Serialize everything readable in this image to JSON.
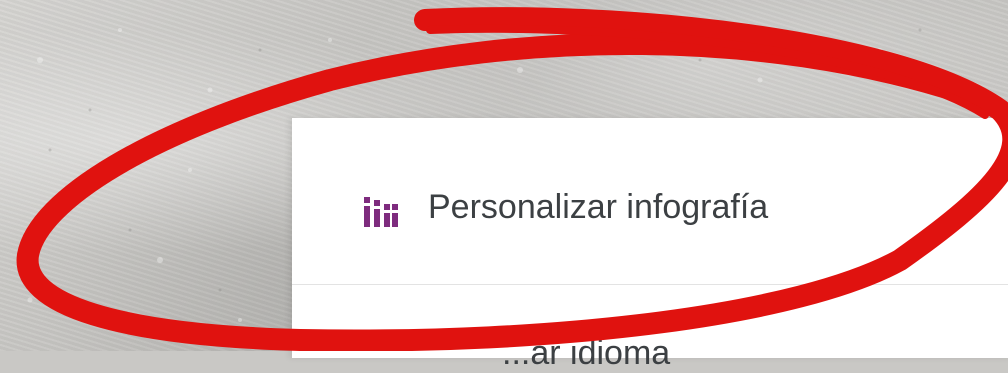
{
  "panel": {
    "header": {
      "icon": "infographic-bars-icon",
      "title": "Personalizar infografía"
    },
    "next_item_label": "...ar idioma"
  },
  "colors": {
    "icon_purple": "#7e2b7e",
    "annotation_red": "#e0120f",
    "title_text": "#3c4043"
  }
}
